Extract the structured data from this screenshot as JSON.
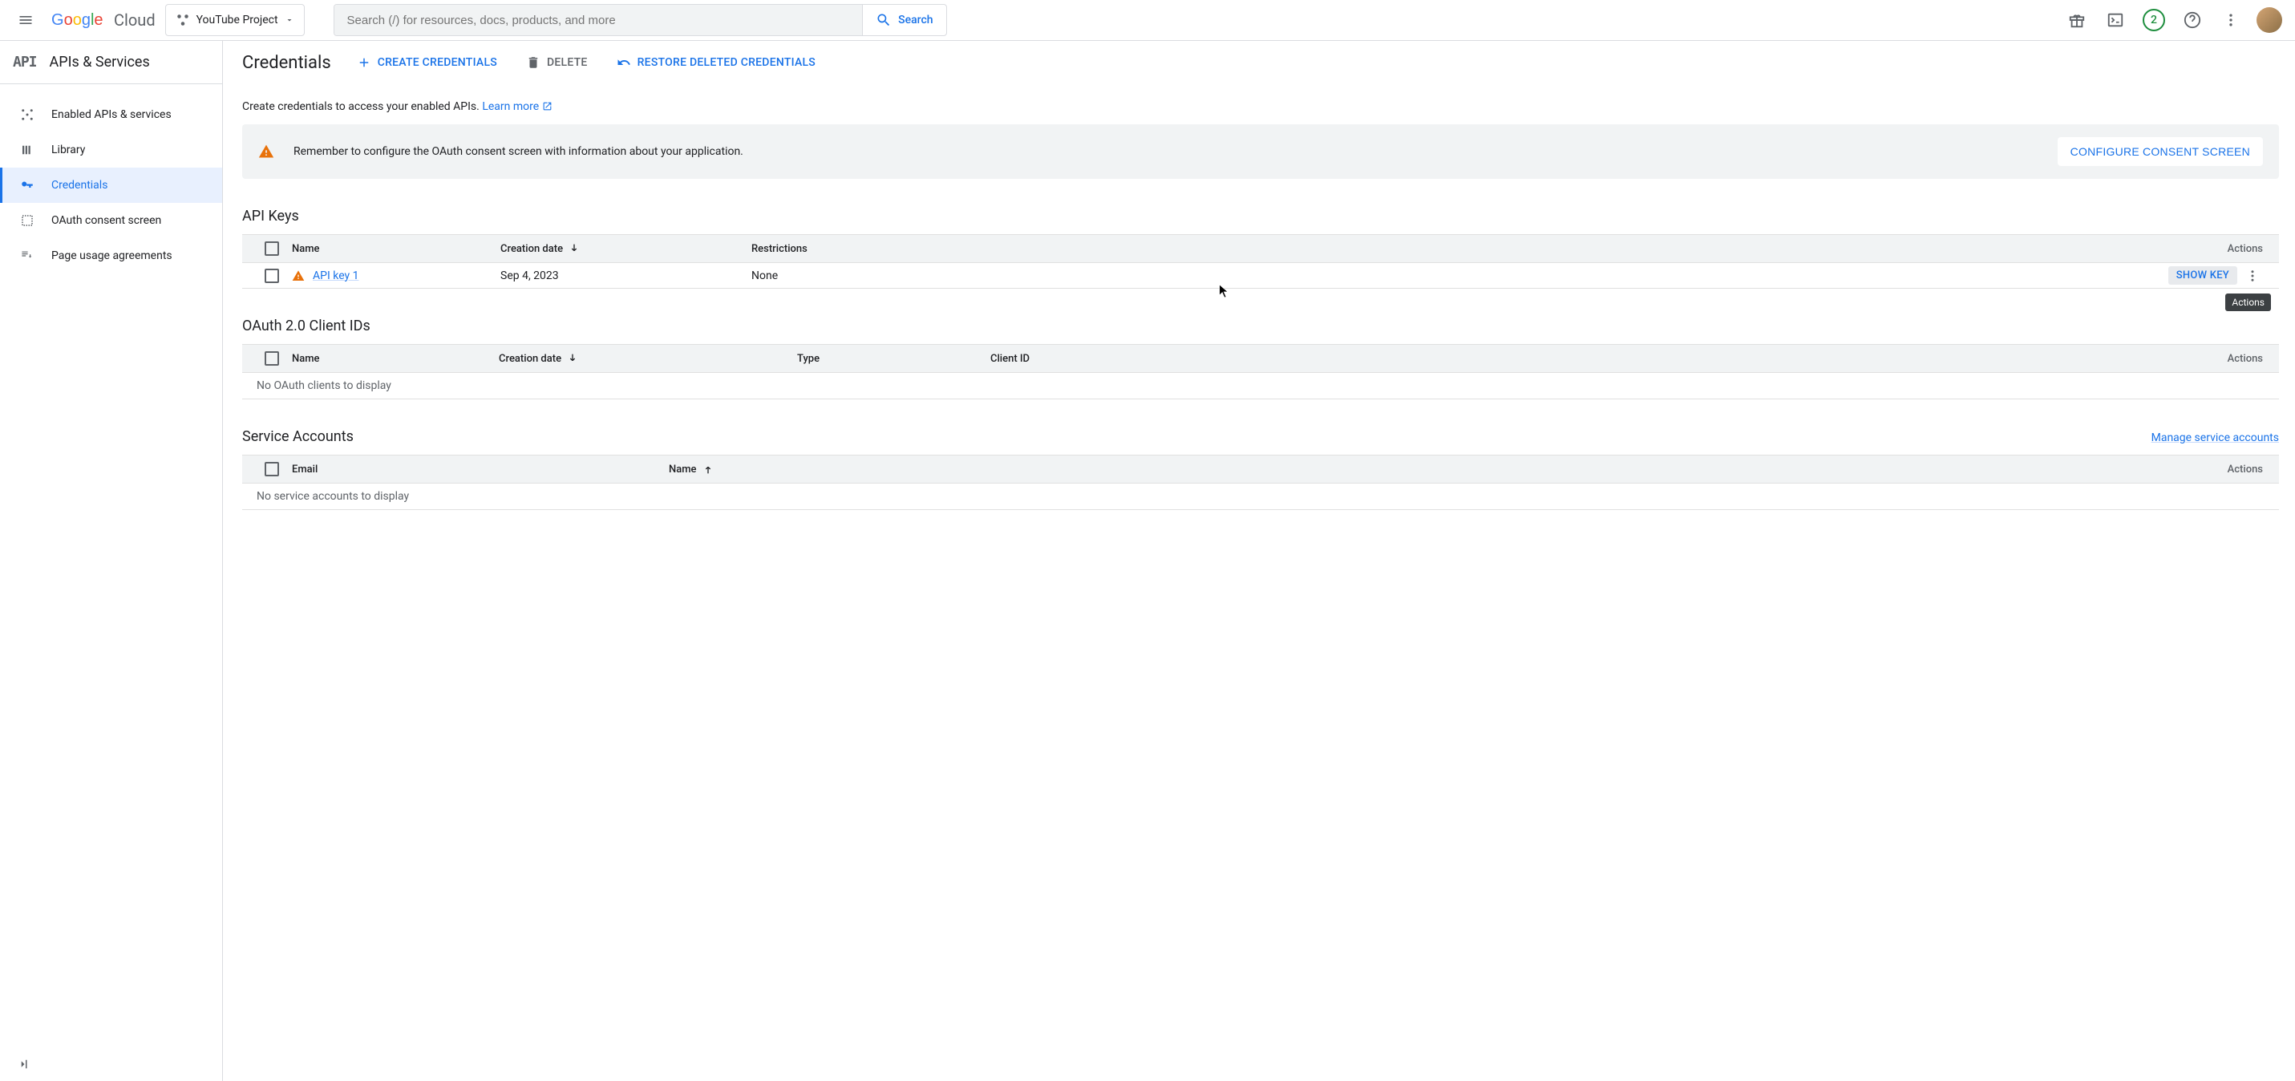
{
  "topbar": {
    "logo_text": "Cloud",
    "project_name": "YouTube Project",
    "search_placeholder": "Search (/) for resources, docs, products, and more",
    "search_button": "Search",
    "trial_count": "2"
  },
  "sidebar": {
    "header_icon": "API",
    "header_title": "APIs & Services",
    "items": [
      {
        "label": "Enabled APIs & services"
      },
      {
        "label": "Library"
      },
      {
        "label": "Credentials"
      },
      {
        "label": "OAuth consent screen"
      },
      {
        "label": "Page usage agreements"
      }
    ]
  },
  "page": {
    "title": "Credentials",
    "actions": {
      "create": "CREATE CREDENTIALS",
      "delete": "DELETE",
      "restore": "RESTORE DELETED CREDENTIALS"
    },
    "intro_text": "Create credentials to access your enabled APIs. ",
    "learn_more": "Learn more",
    "banner": {
      "text": "Remember to configure the OAuth consent screen with information about your application.",
      "button": "CONFIGURE CONSENT SCREEN"
    }
  },
  "api_keys": {
    "title": "API Keys",
    "columns": {
      "name": "Name",
      "created": "Creation date",
      "restrictions": "Restrictions",
      "actions": "Actions"
    },
    "rows": [
      {
        "name": "API key 1",
        "created": "Sep 4, 2023",
        "restrictions": "None",
        "show_key": "SHOW KEY"
      }
    ]
  },
  "oauth": {
    "title": "OAuth 2.0 Client IDs",
    "columns": {
      "name": "Name",
      "created": "Creation date",
      "type": "Type",
      "client_id": "Client ID",
      "actions": "Actions"
    },
    "empty": "No OAuth clients to display"
  },
  "service_accounts": {
    "title": "Service Accounts",
    "manage_link": "Manage service accounts",
    "columns": {
      "email": "Email",
      "name": "Name",
      "actions": "Actions"
    },
    "empty": "No service accounts to display"
  },
  "tooltip": "Actions"
}
